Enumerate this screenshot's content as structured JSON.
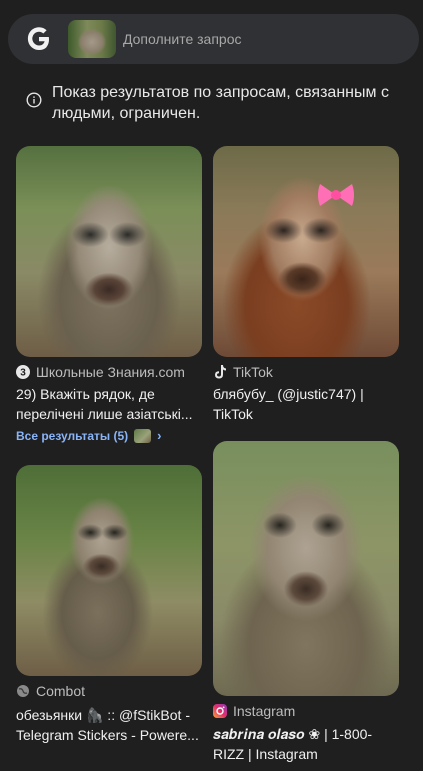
{
  "search": {
    "placeholder": "Дополните запрос"
  },
  "notice": {
    "text": "Показ результатов по запросам, связанным с людьми, ограничен."
  },
  "results": [
    {
      "source": "Школьные Знания.com",
      "source_icon": "znanija-icon",
      "title": "29) Вкажіть рядок, де перелічені лише азіатські..."
    },
    {
      "source": "TikTok",
      "source_icon": "tiktok-icon",
      "title": "блябубу_ (@justic747) | TikTok"
    },
    {
      "source": "Combot",
      "source_icon": "globe-icon",
      "title": "обезьянки 🦍 :: @fStikBot - Telegram Stickers - Powere..."
    },
    {
      "source": "Instagram",
      "source_icon": "instagram-icon",
      "title": "𝒔𝒂𝒃𝒓𝒊𝒏𝒂 𝒐𝒍𝒂𝒔𝒐 ❀ | 1-800-RIZZ | Instagram"
    }
  ],
  "all_results_link": "Все результаты (5)",
  "colors": {
    "background": "#1f1f1f",
    "search_bar": "#303134",
    "link": "#8ab4f8"
  }
}
